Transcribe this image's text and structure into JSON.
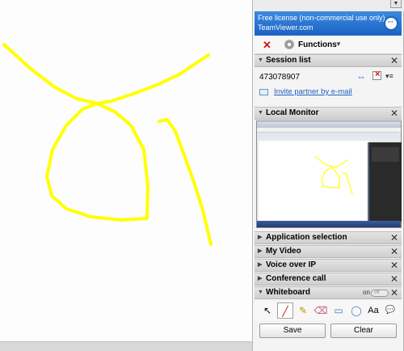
{
  "banner": {
    "line1": "Free license (non-commercial use only)",
    "line2": "TeamViewer.com"
  },
  "toolbar": {
    "close_glyph": "✕",
    "functions_label": "Functions",
    "functions_arrow": "▼"
  },
  "sections": {
    "session_list": "Session list",
    "local_monitor": "Local Monitor",
    "application_selection": "Application selection",
    "my_video": "My Video",
    "voice_over_ip": "Voice over IP",
    "conference_call": "Conference call",
    "whiteboard": "Whiteboard"
  },
  "glyphs": {
    "collapse_open": "▼",
    "collapse_closed": "▶",
    "close": "✕",
    "handle": "▼",
    "session_arrows": "⇔",
    "menu": "▾≡"
  },
  "session": {
    "id": "473078907",
    "invite_label": "Invite partner by e-mail"
  },
  "whiteboard": {
    "toggle_on": "on",
    "toggle_off": "off",
    "tools": [
      {
        "name": "select-tool",
        "glyph": "↖"
      },
      {
        "name": "pen-tool",
        "glyph": "╱"
      },
      {
        "name": "highlighter-tool",
        "glyph": "✎"
      },
      {
        "name": "eraser-tool",
        "glyph": "⌫"
      },
      {
        "name": "rectangle-tool",
        "glyph": "▭"
      },
      {
        "name": "ellipse-tool",
        "glyph": "◯"
      },
      {
        "name": "text-tool",
        "glyph": "Aa"
      },
      {
        "name": "speech-bubble-tool",
        "glyph": "💬"
      }
    ],
    "selected_tool": "pen-tool",
    "save_label": "Save",
    "clear_label": "Clear"
  },
  "colors": {
    "stroke": "#ffff00",
    "banner": "#1b63c3",
    "close_red": "#d81010",
    "link": "#1f5fbf"
  },
  "icons": [
    "close-icon",
    "gear-icon",
    "swap-arrows-icon",
    "stop-session-icon",
    "menu-icon",
    "mail-icon",
    "teamviewer-logo-icon"
  ]
}
